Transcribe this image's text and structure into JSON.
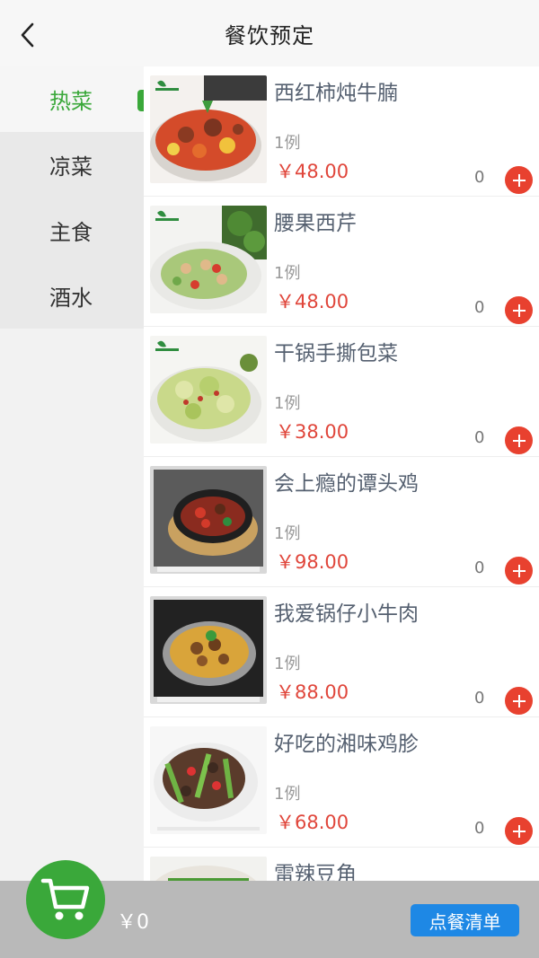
{
  "header": {
    "title": "餐饮预定",
    "back_icon": "chevron-left-icon"
  },
  "sidebar": {
    "categories": [
      {
        "label": "热菜",
        "active": true
      },
      {
        "label": "凉菜",
        "active": false
      },
      {
        "label": "主食",
        "active": false
      },
      {
        "label": "酒水",
        "active": false
      }
    ]
  },
  "dishes": [
    {
      "name": "西红柿炖牛腩",
      "unit": "1例",
      "price": "￥48.00",
      "qty": "0"
    },
    {
      "name": "腰果西芹",
      "unit": "1例",
      "price": "￥48.00",
      "qty": "0"
    },
    {
      "name": "干锅手撕包菜",
      "unit": "1例",
      "price": "￥38.00",
      "qty": "0"
    },
    {
      "name": "会上瘾的谭头鸡",
      "unit": "1例",
      "price": "￥98.00",
      "qty": "0"
    },
    {
      "name": "我爱锅仔小牛肉",
      "unit": "1例",
      "price": "￥88.00",
      "qty": "0"
    },
    {
      "name": "好吃的湘味鸡胗",
      "unit": "1例",
      "price": "￥68.00",
      "qty": "0"
    },
    {
      "name": "雷辣豆角",
      "unit": "",
      "price": "",
      "qty": ""
    }
  ],
  "cart": {
    "total": "￥0",
    "order_list_label": "点餐清单"
  },
  "colors": {
    "accent_green": "#3aa83a",
    "price_red": "#e0463b",
    "add_red": "#e8412f",
    "button_blue": "#1e88e5"
  }
}
